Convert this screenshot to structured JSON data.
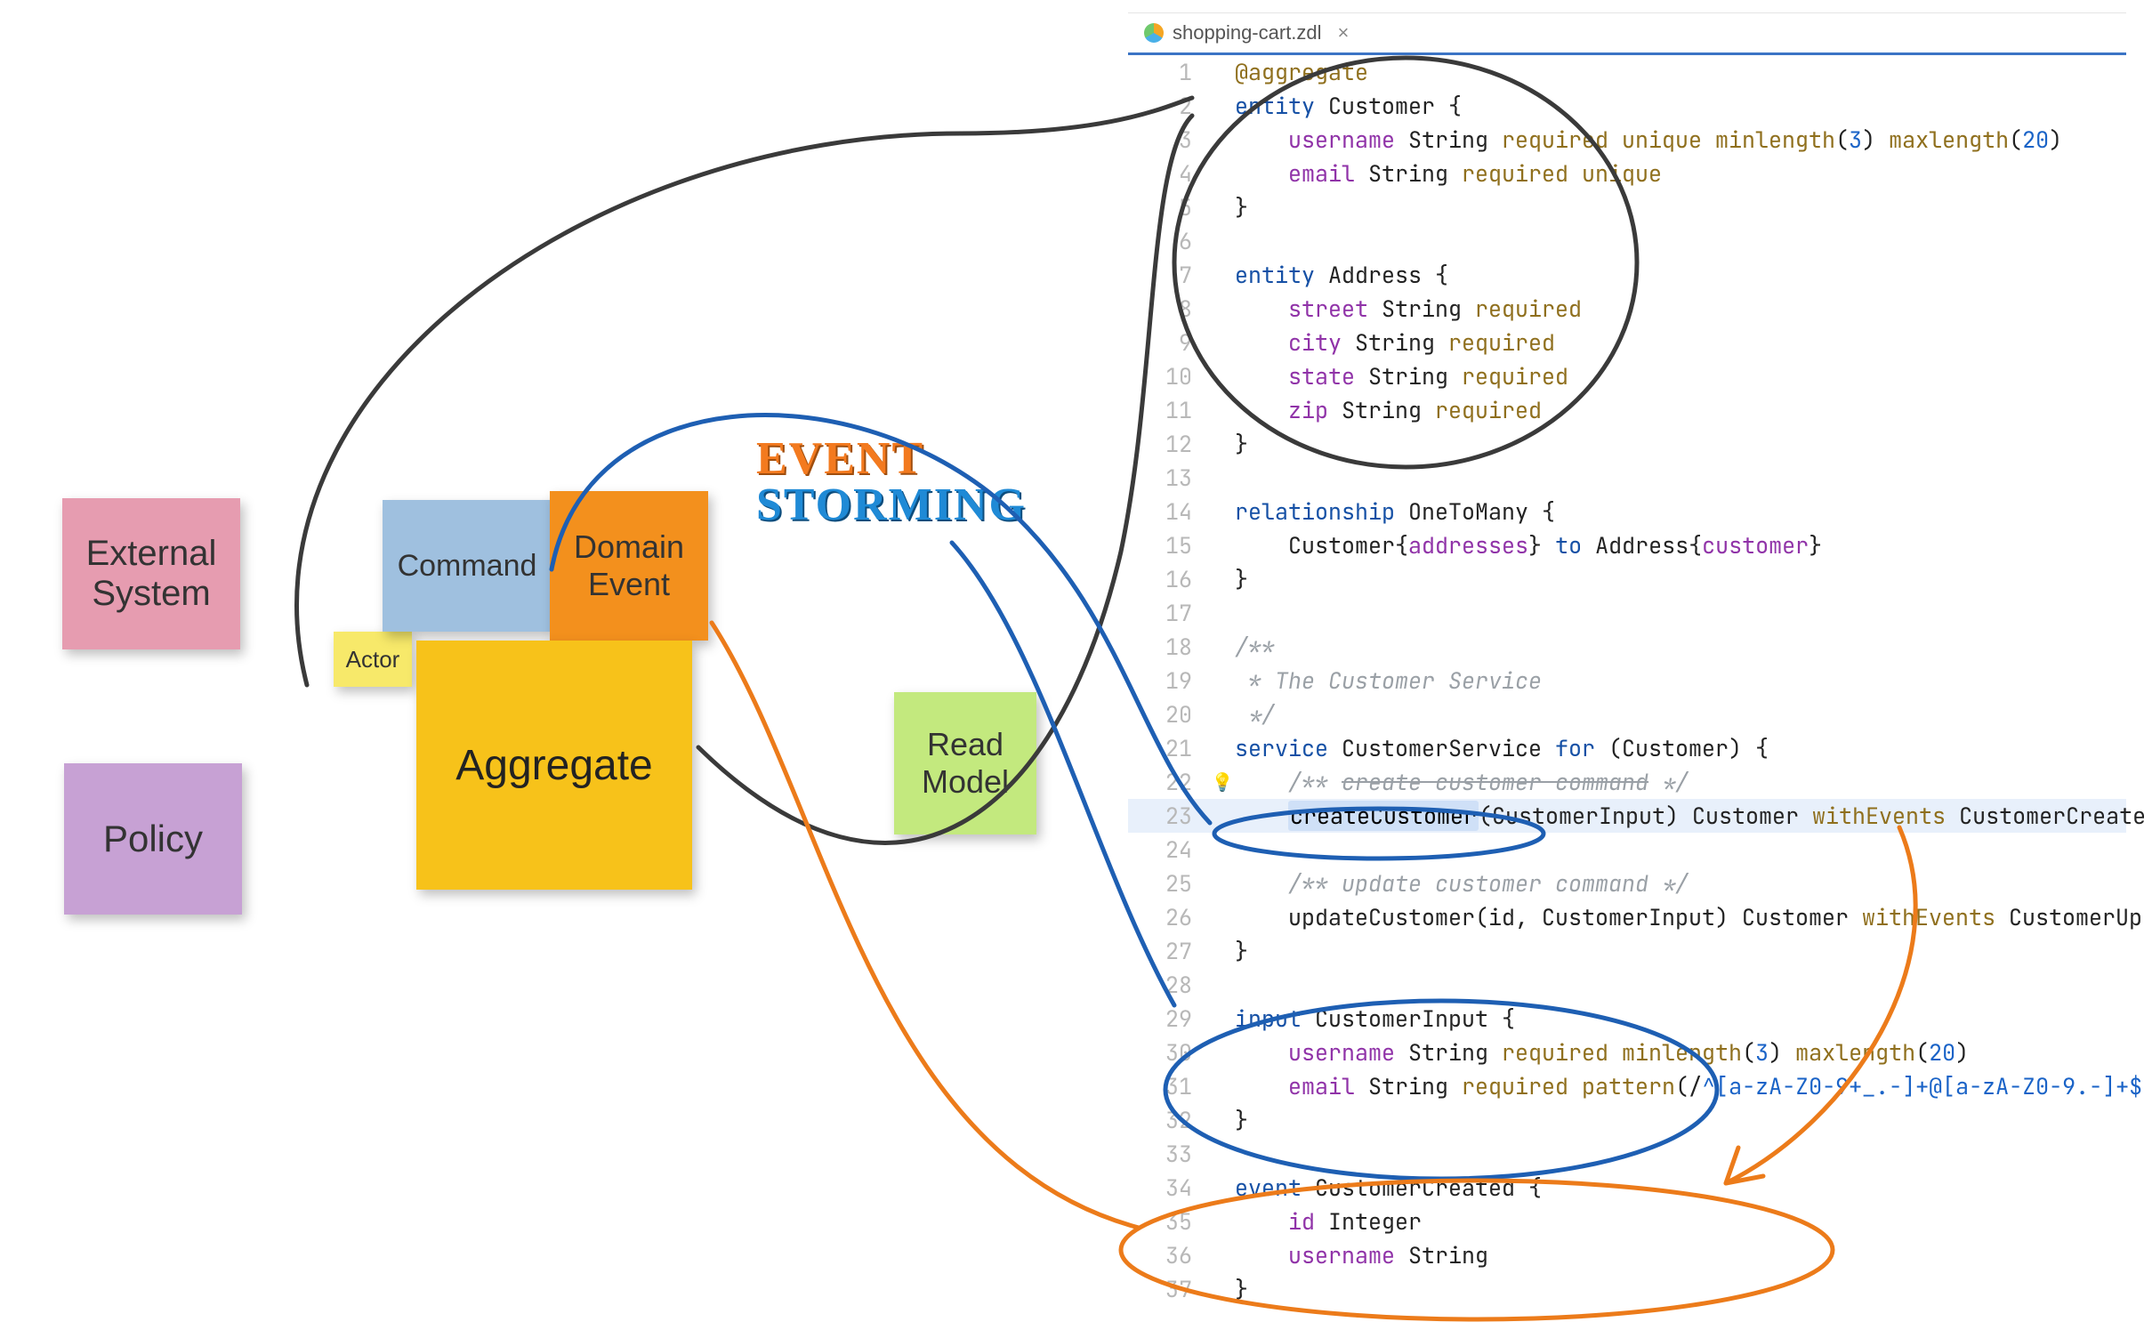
{
  "stickies": {
    "external_system": "External\nSystem",
    "policy": "Policy",
    "actor": "Actor",
    "command": "Command",
    "domain_event": "Domain\nEvent",
    "aggregate": "Aggregate",
    "read_model": "Read\nModel"
  },
  "title": {
    "event": "EVENT",
    "storming": "STORMING"
  },
  "editor": {
    "tab": {
      "filename": "shopping-cart.zdl",
      "close": "×"
    },
    "lines": [
      {
        "n": "1",
        "tok": [
          [
            "a",
            "@aggregate"
          ]
        ]
      },
      {
        "n": "2",
        "tok": [
          [
            "k",
            "entity "
          ],
          [
            "i",
            "Customer {"
          ]
        ]
      },
      {
        "n": "3",
        "tok": [
          [
            "",
            "    "
          ],
          [
            "p",
            "username "
          ],
          [
            "t",
            "String "
          ],
          [
            "a",
            "required unique minlength"
          ],
          [
            "i",
            "("
          ],
          [
            "n",
            "3"
          ],
          [
            "i",
            ") "
          ],
          [
            "a",
            "maxlength"
          ],
          [
            "i",
            "("
          ],
          [
            "n",
            "20"
          ],
          [
            "i",
            ")"
          ]
        ]
      },
      {
        "n": "4",
        "tok": [
          [
            "",
            "    "
          ],
          [
            "p",
            "email "
          ],
          [
            "t",
            "String "
          ],
          [
            "a",
            "required unique"
          ]
        ]
      },
      {
        "n": "5",
        "tok": [
          [
            "i",
            "}"
          ]
        ]
      },
      {
        "n": "6",
        "tok": []
      },
      {
        "n": "7",
        "tok": [
          [
            "k",
            "entity "
          ],
          [
            "i",
            "Address {"
          ]
        ]
      },
      {
        "n": "8",
        "tok": [
          [
            "",
            "    "
          ],
          [
            "p",
            "street "
          ],
          [
            "t",
            "String "
          ],
          [
            "a",
            "required"
          ]
        ]
      },
      {
        "n": "9",
        "tok": [
          [
            "",
            "    "
          ],
          [
            "p",
            "city "
          ],
          [
            "t",
            "String "
          ],
          [
            "a",
            "required"
          ]
        ]
      },
      {
        "n": "10",
        "tok": [
          [
            "",
            "    "
          ],
          [
            "p",
            "state "
          ],
          [
            "t",
            "String "
          ],
          [
            "a",
            "required"
          ]
        ]
      },
      {
        "n": "11",
        "tok": [
          [
            "",
            "    "
          ],
          [
            "p",
            "zip "
          ],
          [
            "t",
            "String "
          ],
          [
            "a",
            "required"
          ]
        ]
      },
      {
        "n": "12",
        "tok": [
          [
            "i",
            "}"
          ]
        ]
      },
      {
        "n": "13",
        "tok": []
      },
      {
        "n": "14",
        "tok": [
          [
            "k",
            "relationship "
          ],
          [
            "i",
            "OneToMany {"
          ]
        ]
      },
      {
        "n": "15",
        "tok": [
          [
            "",
            "    "
          ],
          [
            "i",
            "Customer{"
          ],
          [
            "p",
            "addresses"
          ],
          [
            "i",
            "} "
          ],
          [
            "k",
            "to "
          ],
          [
            "i",
            "Address{"
          ],
          [
            "p",
            "customer"
          ],
          [
            "i",
            "}"
          ]
        ]
      },
      {
        "n": "16",
        "tok": [
          [
            "i",
            "}"
          ]
        ]
      },
      {
        "n": "17",
        "tok": []
      },
      {
        "n": "18",
        "tok": [
          [
            "c",
            "/**"
          ]
        ]
      },
      {
        "n": "19",
        "tok": [
          [
            "c",
            " * The Customer Service"
          ]
        ]
      },
      {
        "n": "20",
        "tok": [
          [
            "c",
            " */"
          ]
        ]
      },
      {
        "n": "21",
        "tok": [
          [
            "k",
            "service "
          ],
          [
            "i",
            "CustomerService "
          ],
          [
            "k",
            "for "
          ],
          [
            "i",
            "(Customer) {"
          ]
        ]
      },
      {
        "n": "22",
        "bulb": true,
        "tok": [
          [
            "",
            "    "
          ],
          [
            "c",
            "/** "
          ],
          [
            "c strike",
            "create customer command"
          ],
          [
            "c",
            " */"
          ]
        ]
      },
      {
        "n": "23",
        "hl": true,
        "tok": [
          [
            "",
            "    "
          ],
          [
            "sel",
            "createCustomer"
          ],
          [
            "i",
            "(CustomerInput) Customer "
          ],
          [
            "a",
            "withEvents "
          ],
          [
            "i",
            "CustomerCreated"
          ]
        ]
      },
      {
        "n": "24",
        "tok": []
      },
      {
        "n": "25",
        "tok": [
          [
            "",
            "    "
          ],
          [
            "c",
            "/** update customer command */"
          ]
        ]
      },
      {
        "n": "26",
        "tok": [
          [
            "",
            "    "
          ],
          [
            "i",
            "updateCustomer(id, CustomerInput) Customer "
          ],
          [
            "a",
            "withEvents "
          ],
          [
            "i",
            "CustomerUpdated"
          ]
        ]
      },
      {
        "n": "27",
        "tok": [
          [
            "i",
            "}"
          ]
        ]
      },
      {
        "n": "28",
        "tok": []
      },
      {
        "n": "29",
        "tok": [
          [
            "k",
            "input "
          ],
          [
            "i",
            "CustomerInput {"
          ]
        ]
      },
      {
        "n": "30",
        "tok": [
          [
            "",
            "    "
          ],
          [
            "p",
            "username "
          ],
          [
            "t",
            "String "
          ],
          [
            "a",
            "required minlength"
          ],
          [
            "i",
            "("
          ],
          [
            "n",
            "3"
          ],
          [
            "i",
            ") "
          ],
          [
            "a",
            "maxlength"
          ],
          [
            "i",
            "("
          ],
          [
            "n",
            "20"
          ],
          [
            "i",
            ")"
          ]
        ]
      },
      {
        "n": "31",
        "tok": [
          [
            "",
            "    "
          ],
          [
            "p",
            "email "
          ],
          [
            "t",
            "String "
          ],
          [
            "a",
            "required pattern"
          ],
          [
            "i",
            "(/"
          ],
          [
            "n",
            "^[a-zA-Z0-9+_.-]+@[a-zA-Z0-9.-]+$"
          ],
          [
            "i",
            "/)"
          ]
        ]
      },
      {
        "n": "32",
        "tok": [
          [
            "i",
            "}"
          ]
        ]
      },
      {
        "n": "33",
        "tok": []
      },
      {
        "n": "34",
        "tok": [
          [
            "k",
            "event "
          ],
          [
            "i",
            "CustomerCreated {"
          ]
        ]
      },
      {
        "n": "35",
        "tok": [
          [
            "",
            "    "
          ],
          [
            "p",
            "id "
          ],
          [
            "t",
            "Integer"
          ]
        ]
      },
      {
        "n": "36",
        "tok": [
          [
            "",
            "    "
          ],
          [
            "p",
            "username "
          ],
          [
            "t",
            "String"
          ]
        ]
      },
      {
        "n": "37",
        "tok": [
          [
            "i",
            "}"
          ]
        ]
      }
    ]
  }
}
